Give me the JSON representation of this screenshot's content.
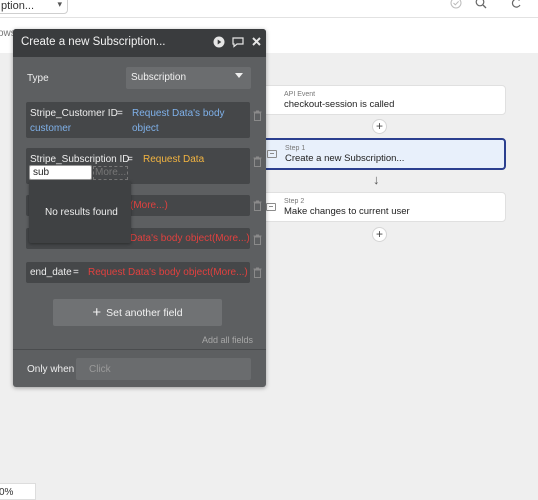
{
  "topbar": {
    "app_select_text": "ption...",
    "left_fragment": "ows"
  },
  "workflow": {
    "event_card": {
      "small": "API Event",
      "title": "checkout-session is called"
    },
    "step1_card": {
      "small": "Step 1",
      "title": "Create a new Subscription..."
    },
    "step2_card": {
      "small": "Step 2",
      "title": "Make changes to current user"
    },
    "plus": "+",
    "arrow": "↓"
  },
  "zoom_level": "0%",
  "modal": {
    "title": "Create a new Subscription...",
    "type_label": "Type",
    "type_value": "Subscription",
    "fields": [
      {
        "name": "Stripe_Customer ID",
        "equals": "=",
        "value_line1": "Request Data's body object",
        "value_line2": "customer"
      },
      {
        "name": "Stripe_Subscription ID",
        "equals": "=",
        "value": "Request Data",
        "input_value": "sub",
        "more": "More..."
      },
      {
        "value_visible": "(More...)"
      },
      {
        "value_visible": "Data's body object(More...)"
      },
      {
        "name": "end_date",
        "equals": "=",
        "value": "Request Data's body object(More...)"
      }
    ],
    "dropdown_message": "No results found",
    "set_field_label": "Set another field",
    "add_all_fields": "Add all fields",
    "only_when_label": "Only when",
    "only_when_placeholder": "Click"
  },
  "colors": {
    "modal_bg": "#5d5f61",
    "modal_header": "#3a3c3e",
    "dynamic_blue": "#7fb1ea",
    "dynamic_orange": "#f2b441",
    "dynamic_red": "#e0413f",
    "selected_border": "#2b3f8f"
  }
}
